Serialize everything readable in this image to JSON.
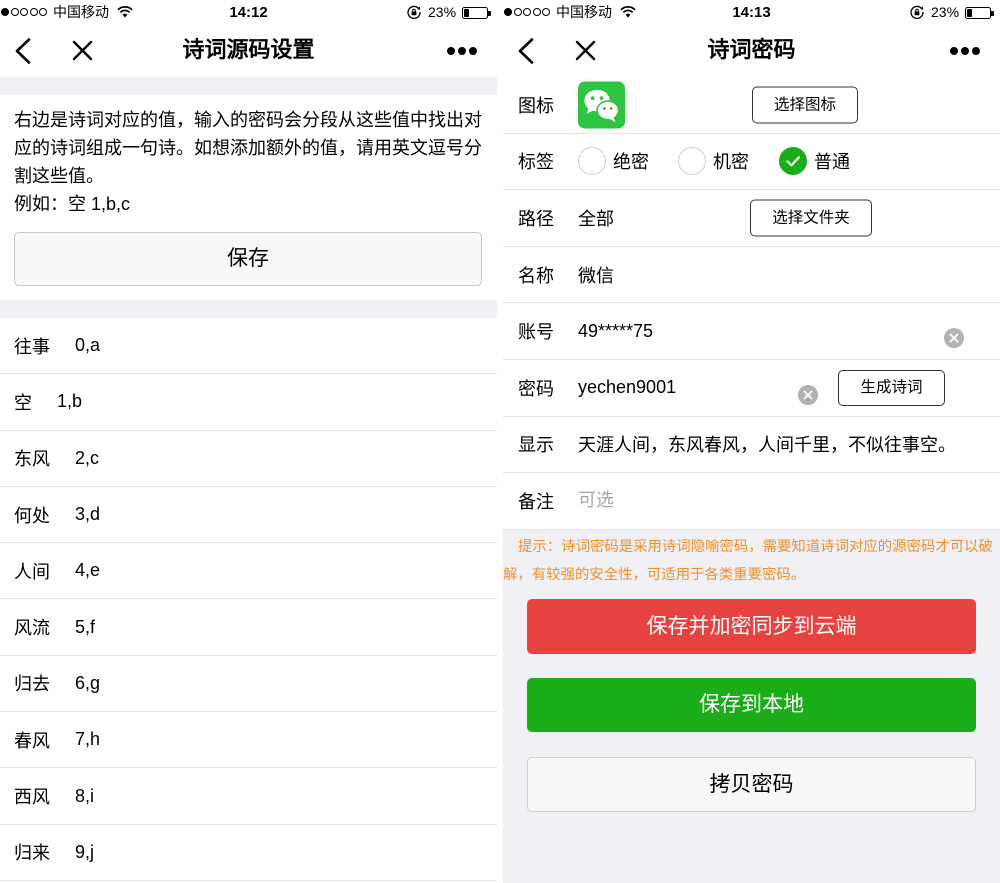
{
  "colors": {
    "primary_green": "#1aad19",
    "danger_red": "#e64340",
    "hint_orange": "#f0902c",
    "page_gray": "#efeff4",
    "wechat_green": "#2dc540"
  },
  "left": {
    "status_bar": {
      "signal_level": 1,
      "carrier": "中国移动",
      "time": "14:12",
      "battery_text": "23%",
      "battery_level": 0.23
    },
    "nav": {
      "title": "诗词源码设置"
    },
    "intro": {
      "lines": [
        "右边是诗词对应的值，输入的密码会分段从这些值中找出对",
        "应的诗词组成一句诗。如想添加额外的值，请用英文逗号分",
        "割这些值。"
      ],
      "example": "例如：空 1,b,c"
    },
    "save_button": "保存",
    "poem_values": [
      {
        "word": "往事",
        "value": "0,a"
      },
      {
        "word": "空",
        "value": "1,b"
      },
      {
        "word": "东风",
        "value": "2,c"
      },
      {
        "word": "何处",
        "value": "3,d"
      },
      {
        "word": "人间",
        "value": "4,e"
      },
      {
        "word": "风流",
        "value": "5,f"
      },
      {
        "word": "归去",
        "value": "6,g"
      },
      {
        "word": "春风",
        "value": "7,h"
      },
      {
        "word": "西风",
        "value": "8,i"
      },
      {
        "word": "归来",
        "value": "9,j"
      }
    ]
  },
  "right": {
    "status_bar": {
      "signal_level": 1,
      "carrier": "中国移动",
      "time": "14:13",
      "battery_text": "23%",
      "battery_level": 0.23
    },
    "nav": {
      "title": "诗词密码"
    },
    "form": {
      "icon": {
        "label": "图标",
        "icon_name": "wechat-icon",
        "button": "选择图标"
      },
      "tag": {
        "label": "标签",
        "options": [
          {
            "label": "绝密",
            "checked": false
          },
          {
            "label": "机密",
            "checked": false
          },
          {
            "label": "普通",
            "checked": true
          }
        ]
      },
      "path": {
        "label": "路径",
        "value": "全部",
        "button": "选择文件夹"
      },
      "name": {
        "label": "名称",
        "value": "微信"
      },
      "account": {
        "label": "账号",
        "value": "49*****75"
      },
      "password": {
        "label": "密码",
        "value": "yechen9001",
        "button": "生成诗词"
      },
      "display": {
        "label": "显示",
        "value": "天涯人间，东风春风，人间千里，不似往事空。"
      },
      "remark": {
        "label": "备注",
        "placeholder": "可选"
      }
    },
    "hint_lines": [
      "提示：诗词密码是采用诗词隐喻密码，需要知道诗词对应的源密码才可以破",
      "解，有较强的安全性，可适用于各类重要密码。"
    ],
    "buttons": {
      "sync": "保存并加密同步到云端",
      "local": "保存到本地",
      "copy": "拷贝密码"
    }
  }
}
